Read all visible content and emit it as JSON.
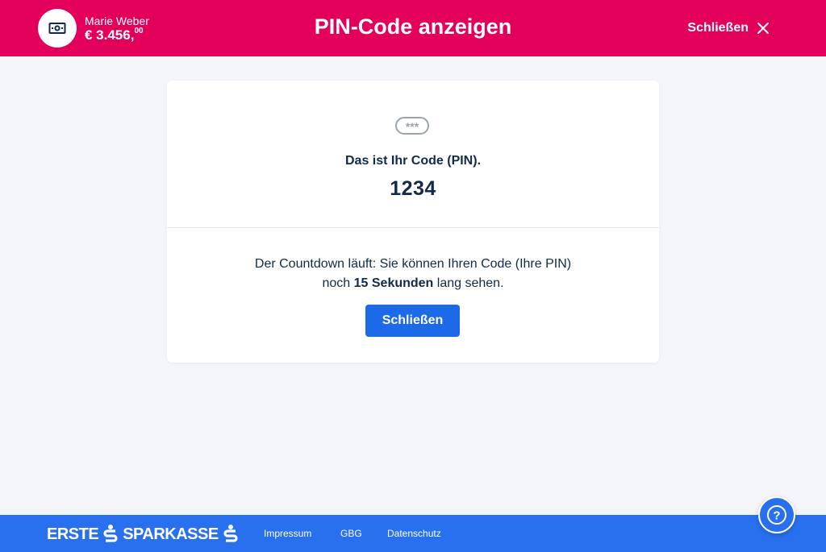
{
  "header": {
    "account_name": "Marie Weber",
    "account_balance_main": "€ 3.456,",
    "account_balance_cents": "00",
    "title": "PIN-Code anzeigen",
    "close_label": "Schließen",
    "icons": {
      "avatar": "banknote-icon",
      "close": "close-icon"
    }
  },
  "card": {
    "pin_icon": "pin-asterisks-icon",
    "pin_icon_text": "***",
    "pin_label": "Das ist Ihr Code (PIN).",
    "pin_value": "1234",
    "countdown_line1": "Der Countdown läuft: Sie können Ihren Code (Ihre PIN)",
    "countdown_prefix": "noch",
    "countdown_seconds": "15 Sekunden",
    "countdown_suffix": "lang sehen.",
    "close_button_label": "Schließen"
  },
  "footer": {
    "brand_left": "ERSTE",
    "brand_right": "SPARKASSE",
    "links": [
      "Impressum",
      "GBG",
      "Datenschutz"
    ]
  },
  "help": {
    "icon": "help-question-icon",
    "symbol": "?"
  },
  "colors": {
    "header_bg": "#e2005a",
    "footer_bg": "#2870ed",
    "primary_button": "#1c6ae8",
    "page_bg": "#f3f5f9",
    "text_dark": "#13294b"
  }
}
